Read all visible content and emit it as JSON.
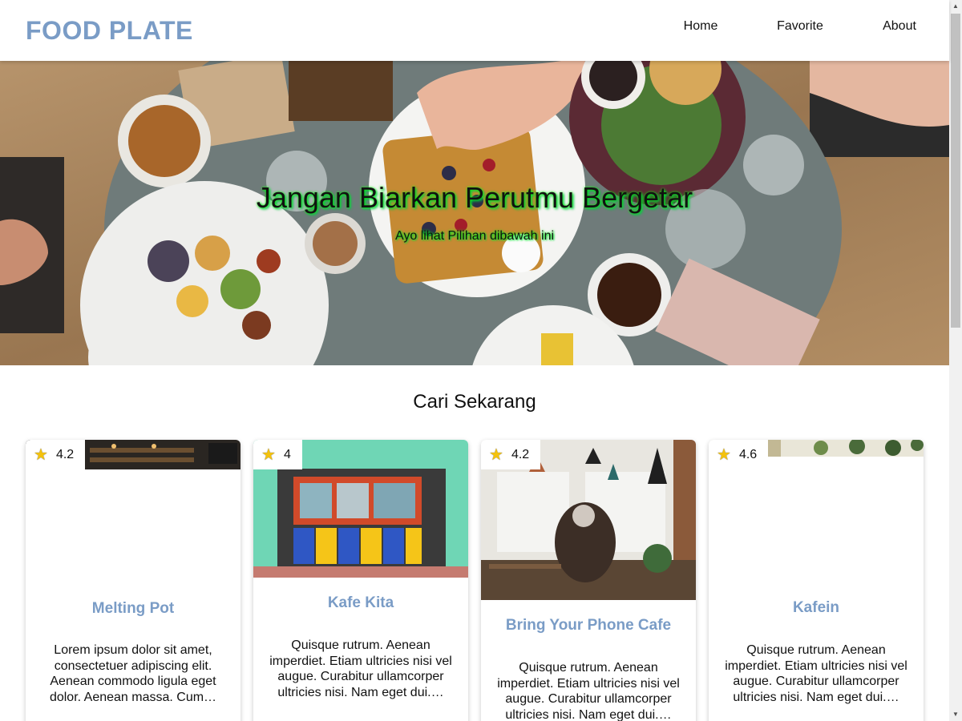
{
  "brand": "FOOD PLATE",
  "nav": [
    {
      "label": "Home"
    },
    {
      "label": "Favorite"
    },
    {
      "label": "About"
    }
  ],
  "hero": {
    "title": "Jangan Biarkan Perutmu Bergetar",
    "subtitle": "Ayo lihat Pilihan dibawah ini"
  },
  "section_title": "Cari Sekarang",
  "restaurants": [
    {
      "rating": "4.2",
      "name": "Melting Pot",
      "description": "Lorem ipsum dolor sit amet, consectetuer adipiscing elit. Aenean commodo ligula eget dolor. Aenean massa. Cum…"
    },
    {
      "rating": "4",
      "name": "Kafe Kita",
      "description": "Quisque rutrum. Aenean imperdiet. Etiam ultricies nisi vel augue. Curabitur ullamcorper ultricies nisi. Nam eget dui.…"
    },
    {
      "rating": "4.2",
      "name": "Bring Your Phone Cafe",
      "description": "Quisque rutrum. Aenean imperdiet. Etiam ultricies nisi vel augue. Curabitur ullamcorper ultricies nisi. Nam eget dui.…"
    },
    {
      "rating": "4.6",
      "name": "Kafein",
      "description": "Quisque rutrum. Aenean imperdiet. Etiam ultricies nisi vel augue. Curabitur ullamcorper ultricies nisi. Nam eget dui.…"
    }
  ],
  "icons": {
    "rating": "star-icon"
  },
  "colors": {
    "brand": "#7a9cc6",
    "star": "#f4c20d",
    "hero_text_glow": "#00cc44"
  }
}
